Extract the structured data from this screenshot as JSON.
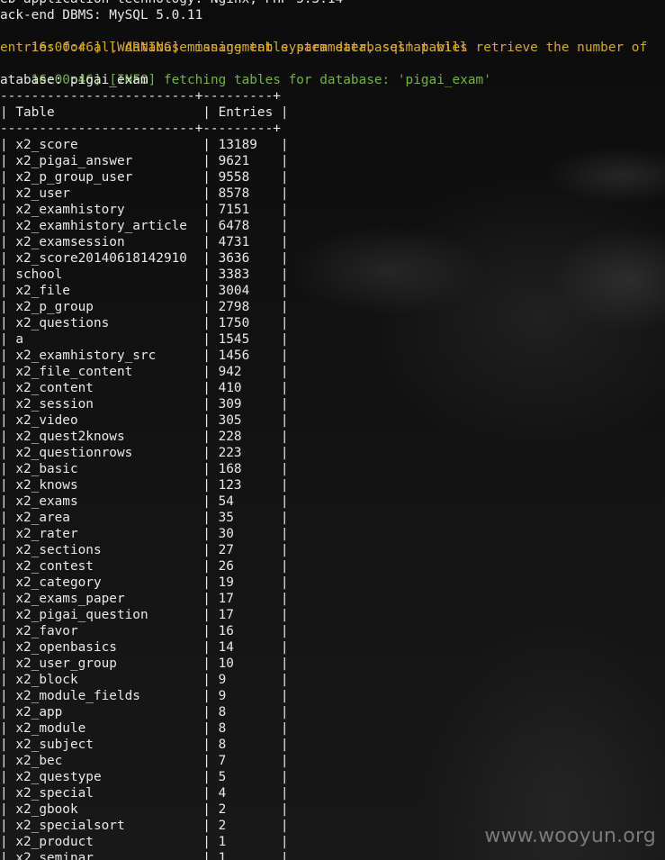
{
  "header": {
    "web_tech_line": "eb application technology: Nginx, PHP 5.3.14",
    "dbms_line": "ack-end DBMS: MySQL 5.0.11"
  },
  "warning": {
    "time": "16:00:46]",
    "tag": "[WARNING]",
    "message_1": "missing table parameter, sqlmap will retrieve the number of",
    "message_2": "entries for all database management system databases' tables"
  },
  "info": {
    "time": "16:00:46]",
    "tag": "[INFO]",
    "message": "fetching tables for database: 'pigai_exam'"
  },
  "database_line": "atabase: pigai_exam",
  "table": {
    "border_top": "-------------------------+---------+",
    "header_row": "| Table                   | Entries |",
    "border_mid": "-------------------------+---------+",
    "columns": [
      "Table",
      "Entries"
    ],
    "rows": [
      {
        "name": "x2_score",
        "entries": "13189"
      },
      {
        "name": "x2_pigai_answer",
        "entries": "9621"
      },
      {
        "name": "x2_p_group_user",
        "entries": "9558"
      },
      {
        "name": "x2_user",
        "entries": "8578"
      },
      {
        "name": "x2_examhistory",
        "entries": "7151"
      },
      {
        "name": "x2_examhistory_article",
        "entries": "6478"
      },
      {
        "name": "x2_examsession",
        "entries": "4731"
      },
      {
        "name": "x2_score20140618142910",
        "entries": "3636"
      },
      {
        "name": "school",
        "entries": "3383"
      },
      {
        "name": "x2_file",
        "entries": "3004"
      },
      {
        "name": "x2_p_group",
        "entries": "2798"
      },
      {
        "name": "x2_questions",
        "entries": "1750"
      },
      {
        "name": "a",
        "entries": "1545"
      },
      {
        "name": "x2_examhistory_src",
        "entries": "1456"
      },
      {
        "name": "x2_file_content",
        "entries": "942"
      },
      {
        "name": "x2_content",
        "entries": "410"
      },
      {
        "name": "x2_session",
        "entries": "309"
      },
      {
        "name": "x2_video",
        "entries": "305"
      },
      {
        "name": "x2_quest2knows",
        "entries": "228"
      },
      {
        "name": "x2_questionrows",
        "entries": "223"
      },
      {
        "name": "x2_basic",
        "entries": "168"
      },
      {
        "name": "x2_knows",
        "entries": "123"
      },
      {
        "name": "x2_exams",
        "entries": "54"
      },
      {
        "name": "x2_area",
        "entries": "35"
      },
      {
        "name": "x2_rater",
        "entries": "30"
      },
      {
        "name": "x2_sections",
        "entries": "27"
      },
      {
        "name": "x2_contest",
        "entries": "26"
      },
      {
        "name": "x2_category",
        "entries": "19"
      },
      {
        "name": "x2_exams_paper",
        "entries": "17"
      },
      {
        "name": "x2_pigai_question",
        "entries": "17"
      },
      {
        "name": "x2_favor",
        "entries": "16"
      },
      {
        "name": "x2_openbasics",
        "entries": "14"
      },
      {
        "name": "x2_user_group",
        "entries": "10"
      },
      {
        "name": "x2_block",
        "entries": "9"
      },
      {
        "name": "x2_module_fields",
        "entries": "9"
      },
      {
        "name": "x2_app",
        "entries": "8"
      },
      {
        "name": "x2_module",
        "entries": "8"
      },
      {
        "name": "x2_subject",
        "entries": "8"
      },
      {
        "name": "x2_bec",
        "entries": "7"
      },
      {
        "name": "x2_questype",
        "entries": "5"
      },
      {
        "name": "x2_special",
        "entries": "4"
      },
      {
        "name": "x2_gbook",
        "entries": "2"
      },
      {
        "name": "x2_specialsort",
        "entries": "2"
      },
      {
        "name": "x2_product",
        "entries": "1"
      },
      {
        "name": "x2_seminar",
        "entries": "1"
      }
    ]
  },
  "watermark": "www.wooyun.org",
  "colors": {
    "warning": "#d7a52a",
    "info": "#6fb43c",
    "text": "#e8e8e8"
  }
}
